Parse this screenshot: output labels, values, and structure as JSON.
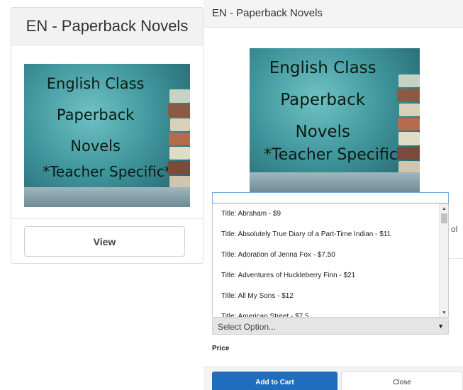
{
  "card": {
    "title": "EN - Paperback Novels",
    "view_label": "View"
  },
  "cover": {
    "lines": [
      "English Class",
      "Paperback",
      "Novels",
      "*Teacher Specific*"
    ]
  },
  "panel": {
    "title": "EN - Paperback Novels",
    "stub_text": "ol",
    "options": [
      "Title: Abraham - $9",
      "Title: Absolutely True Diary of a Part-Time Indian - $11",
      "Title: Adoration of Jenna Fox - $7.50",
      "Title: Adventures of Huckleberry Finn - $21",
      "Title: All My Sons - $12",
      "Title: American Street - $7.5"
    ],
    "select_value": "Select Option...",
    "price_label": "Price",
    "add_to_cart_label": "Add to Cart",
    "close_label": "Close"
  },
  "icons": {
    "select_arrow": "caret-down-icon",
    "scroll_up": "scroll-up-icon",
    "scroll_down": "scroll-down-icon"
  },
  "colors": {
    "primary_button": "#1f6dbc",
    "cover_teal": "#3f969c"
  }
}
